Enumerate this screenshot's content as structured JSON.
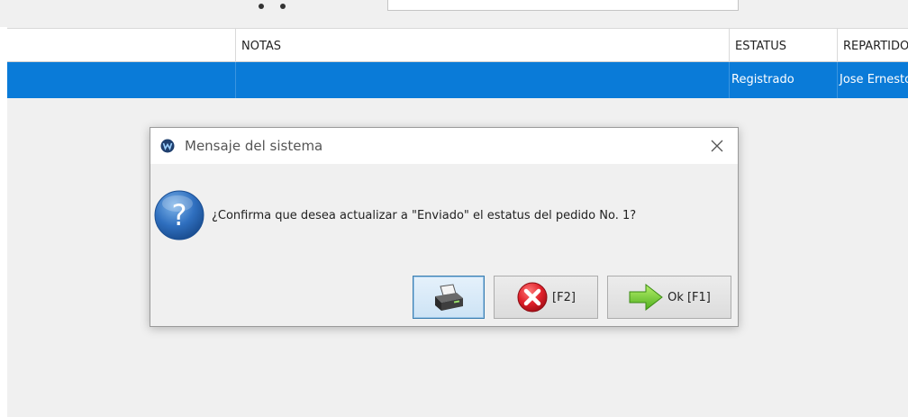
{
  "table": {
    "headers": [
      "",
      "NOTAS",
      "ESTATUS",
      "REPARTIDOR"
    ],
    "selected_row": [
      "",
      "",
      "Registrado",
      "Jose Ernesto"
    ]
  },
  "dialog": {
    "title": "Mensaje del sistema",
    "message": "¿Confirma que desea actualizar a \"Enviado\" el estatus del pedido No. 1?",
    "buttons": {
      "print_icon": "printer-icon",
      "cancel_label": "[F2]",
      "cancel_icon": "red-x-icon",
      "ok_label": "Ok [F1]",
      "ok_icon": "green-arrow-icon"
    }
  },
  "colors": {
    "selection": "#0a7bd8",
    "dialog_bg": "#f0f0f0",
    "focused_button": "#cde3f5"
  }
}
